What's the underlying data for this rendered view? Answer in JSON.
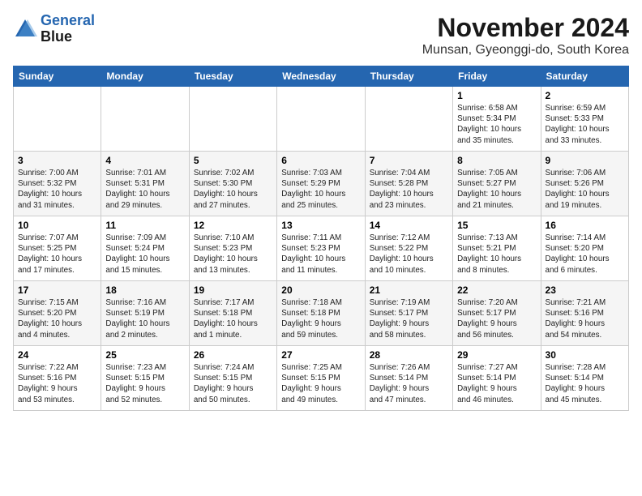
{
  "header": {
    "logo_line1": "General",
    "logo_line2": "Blue",
    "month_title": "November 2024",
    "location": "Munsan, Gyeonggi-do, South Korea"
  },
  "columns": [
    "Sunday",
    "Monday",
    "Tuesday",
    "Wednesday",
    "Thursday",
    "Friday",
    "Saturday"
  ],
  "weeks": [
    [
      {
        "day": "",
        "info": ""
      },
      {
        "day": "",
        "info": ""
      },
      {
        "day": "",
        "info": ""
      },
      {
        "day": "",
        "info": ""
      },
      {
        "day": "",
        "info": ""
      },
      {
        "day": "1",
        "info": "Sunrise: 6:58 AM\nSunset: 5:34 PM\nDaylight: 10 hours\nand 35 minutes."
      },
      {
        "day": "2",
        "info": "Sunrise: 6:59 AM\nSunset: 5:33 PM\nDaylight: 10 hours\nand 33 minutes."
      }
    ],
    [
      {
        "day": "3",
        "info": "Sunrise: 7:00 AM\nSunset: 5:32 PM\nDaylight: 10 hours\nand 31 minutes."
      },
      {
        "day": "4",
        "info": "Sunrise: 7:01 AM\nSunset: 5:31 PM\nDaylight: 10 hours\nand 29 minutes."
      },
      {
        "day": "5",
        "info": "Sunrise: 7:02 AM\nSunset: 5:30 PM\nDaylight: 10 hours\nand 27 minutes."
      },
      {
        "day": "6",
        "info": "Sunrise: 7:03 AM\nSunset: 5:29 PM\nDaylight: 10 hours\nand 25 minutes."
      },
      {
        "day": "7",
        "info": "Sunrise: 7:04 AM\nSunset: 5:28 PM\nDaylight: 10 hours\nand 23 minutes."
      },
      {
        "day": "8",
        "info": "Sunrise: 7:05 AM\nSunset: 5:27 PM\nDaylight: 10 hours\nand 21 minutes."
      },
      {
        "day": "9",
        "info": "Sunrise: 7:06 AM\nSunset: 5:26 PM\nDaylight: 10 hours\nand 19 minutes."
      }
    ],
    [
      {
        "day": "10",
        "info": "Sunrise: 7:07 AM\nSunset: 5:25 PM\nDaylight: 10 hours\nand 17 minutes."
      },
      {
        "day": "11",
        "info": "Sunrise: 7:09 AM\nSunset: 5:24 PM\nDaylight: 10 hours\nand 15 minutes."
      },
      {
        "day": "12",
        "info": "Sunrise: 7:10 AM\nSunset: 5:23 PM\nDaylight: 10 hours\nand 13 minutes."
      },
      {
        "day": "13",
        "info": "Sunrise: 7:11 AM\nSunset: 5:23 PM\nDaylight: 10 hours\nand 11 minutes."
      },
      {
        "day": "14",
        "info": "Sunrise: 7:12 AM\nSunset: 5:22 PM\nDaylight: 10 hours\nand 10 minutes."
      },
      {
        "day": "15",
        "info": "Sunrise: 7:13 AM\nSunset: 5:21 PM\nDaylight: 10 hours\nand 8 minutes."
      },
      {
        "day": "16",
        "info": "Sunrise: 7:14 AM\nSunset: 5:20 PM\nDaylight: 10 hours\nand 6 minutes."
      }
    ],
    [
      {
        "day": "17",
        "info": "Sunrise: 7:15 AM\nSunset: 5:20 PM\nDaylight: 10 hours\nand 4 minutes."
      },
      {
        "day": "18",
        "info": "Sunrise: 7:16 AM\nSunset: 5:19 PM\nDaylight: 10 hours\nand 2 minutes."
      },
      {
        "day": "19",
        "info": "Sunrise: 7:17 AM\nSunset: 5:18 PM\nDaylight: 10 hours\nand 1 minute."
      },
      {
        "day": "20",
        "info": "Sunrise: 7:18 AM\nSunset: 5:18 PM\nDaylight: 9 hours\nand 59 minutes."
      },
      {
        "day": "21",
        "info": "Sunrise: 7:19 AM\nSunset: 5:17 PM\nDaylight: 9 hours\nand 58 minutes."
      },
      {
        "day": "22",
        "info": "Sunrise: 7:20 AM\nSunset: 5:17 PM\nDaylight: 9 hours\nand 56 minutes."
      },
      {
        "day": "23",
        "info": "Sunrise: 7:21 AM\nSunset: 5:16 PM\nDaylight: 9 hours\nand 54 minutes."
      }
    ],
    [
      {
        "day": "24",
        "info": "Sunrise: 7:22 AM\nSunset: 5:16 PM\nDaylight: 9 hours\nand 53 minutes."
      },
      {
        "day": "25",
        "info": "Sunrise: 7:23 AM\nSunset: 5:15 PM\nDaylight: 9 hours\nand 52 minutes."
      },
      {
        "day": "26",
        "info": "Sunrise: 7:24 AM\nSunset: 5:15 PM\nDaylight: 9 hours\nand 50 minutes."
      },
      {
        "day": "27",
        "info": "Sunrise: 7:25 AM\nSunset: 5:15 PM\nDaylight: 9 hours\nand 49 minutes."
      },
      {
        "day": "28",
        "info": "Sunrise: 7:26 AM\nSunset: 5:14 PM\nDaylight: 9 hours\nand 47 minutes."
      },
      {
        "day": "29",
        "info": "Sunrise: 7:27 AM\nSunset: 5:14 PM\nDaylight: 9 hours\nand 46 minutes."
      },
      {
        "day": "30",
        "info": "Sunrise: 7:28 AM\nSunset: 5:14 PM\nDaylight: 9 hours\nand 45 minutes."
      }
    ]
  ]
}
